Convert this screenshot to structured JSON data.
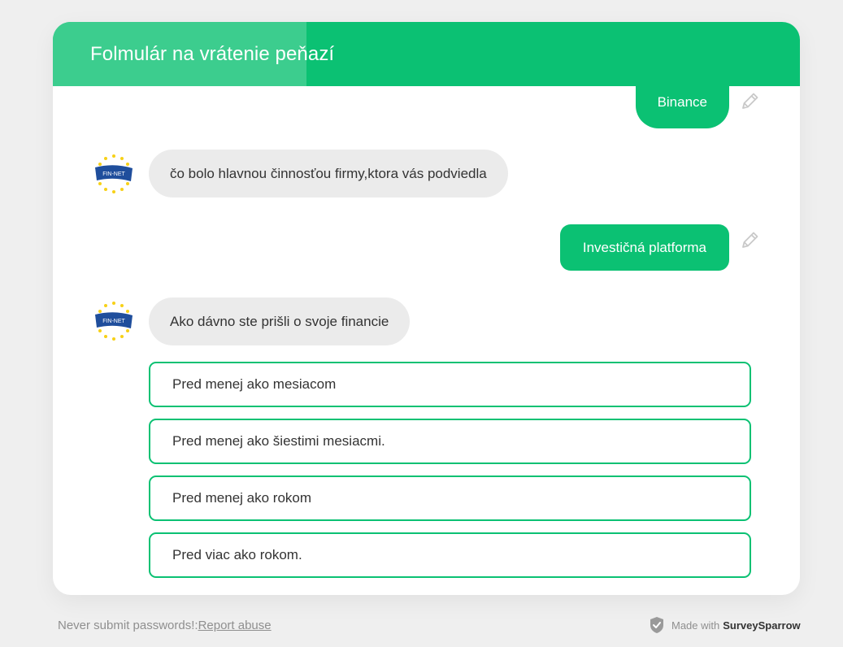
{
  "header": {
    "title": "Folmulár na vrátenie peňazí",
    "progress": 0.34,
    "accent_color": "#0bc173"
  },
  "chat": {
    "answer_1": "Binance",
    "question_1": "čo bolo hlavnou činnosťou firmy,ktora vás podviedla",
    "answer_2": "Investičná platforma",
    "question_2": "Ako dávno ste prišli o svoje financie",
    "bot_avatar_label": "FIN-NET",
    "edit_icon": "pencil-icon"
  },
  "options": [
    "Pred menej ako mesiacom",
    "Pred menej ako šiestimi mesiacmi.",
    "Pred menej ako rokom",
    "Pred viac ako rokom."
  ],
  "footer": {
    "warning": "Never submit passwords!:",
    "report_link": "Report abuse",
    "made_with": "Made with",
    "brand": "SurveySparrow"
  }
}
